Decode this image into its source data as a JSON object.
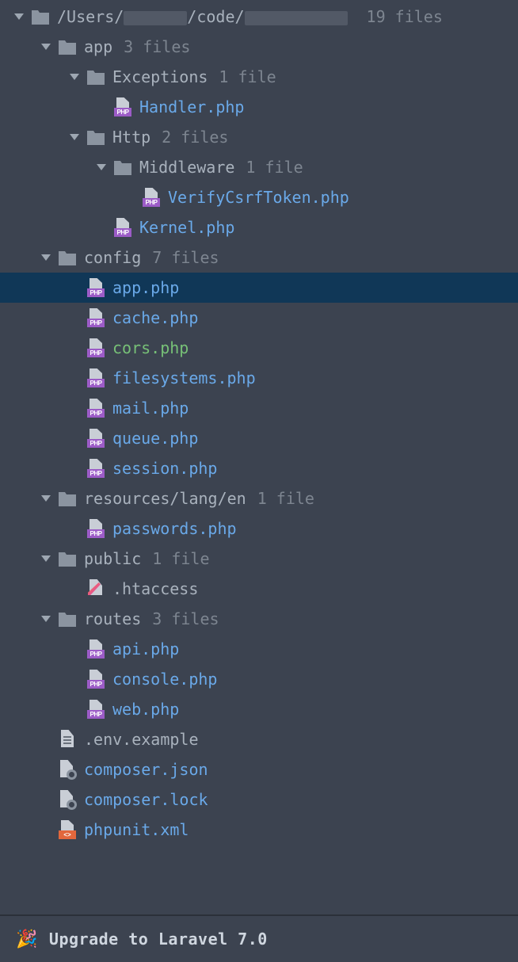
{
  "root": {
    "path_prefix": "/Users/",
    "path_mid": "/code/",
    "count": "19 files"
  },
  "app": {
    "name": "app",
    "count": "3 files",
    "exceptions": {
      "name": "Exceptions",
      "count": "1 file",
      "handler": "Handler.php"
    },
    "http": {
      "name": "Http",
      "count": "2 files",
      "middleware": {
        "name": "Middleware",
        "count": "1 file",
        "verify": "VerifyCsrfToken.php"
      },
      "kernel": "Kernel.php"
    }
  },
  "config": {
    "name": "config",
    "count": "7 files",
    "app": "app.php",
    "cache": "cache.php",
    "cors": "cors.php",
    "filesystems": "filesystems.php",
    "mail": "mail.php",
    "queue": "queue.php",
    "session": "session.php"
  },
  "resources": {
    "name": "resources/lang/en",
    "count": "1 file",
    "passwords": "passwords.php"
  },
  "public": {
    "name": "public",
    "count": "1 file",
    "htaccess": ".htaccess"
  },
  "routes": {
    "name": "routes",
    "count": "3 files",
    "api": "api.php",
    "console": "console.php",
    "web": "web.php"
  },
  "rootfiles": {
    "env": ".env.example",
    "composer_json": "composer.json",
    "composer_lock": "composer.lock",
    "phpunit": "phpunit.xml"
  },
  "footer": {
    "text": "Upgrade to Laravel 7.0"
  },
  "icons": {
    "php_badge": "PHP",
    "xml_badge": "<>"
  }
}
